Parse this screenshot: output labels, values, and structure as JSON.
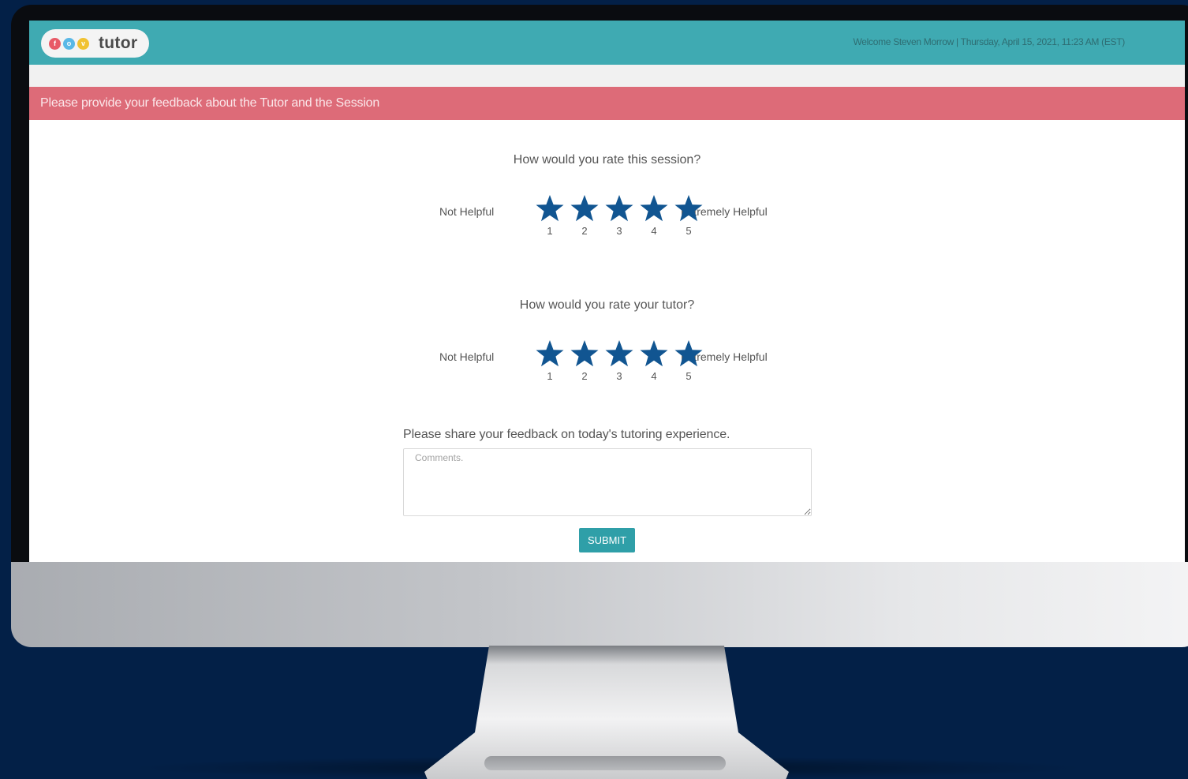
{
  "app": {
    "logo_text": "tutor",
    "logo_dots": [
      {
        "letter": "f",
        "color": "#e85a67"
      },
      {
        "letter": "o",
        "color": "#5ab8e6"
      },
      {
        "letter": "v",
        "color": "#f1c232"
      }
    ],
    "welcome_text": "Welcome Steven Morrow | Thursday, April 15, 2021, 11:23 AM (EST)"
  },
  "alert": {
    "text": "Please provide your feedback about the Tutor and the Session"
  },
  "ratings": [
    {
      "question": "How would you rate this session?",
      "low_label": "Not Helpful",
      "high_label": "Extremely Helpful",
      "scale": [
        "1",
        "2",
        "3",
        "4",
        "5"
      ]
    },
    {
      "question": "How would you rate your tutor?",
      "low_label": "Not Helpful",
      "high_label": "Extremely Helpful",
      "scale": [
        "1",
        "2",
        "3",
        "4",
        "5"
      ]
    }
  ],
  "feedback": {
    "label": "Please share your feedback on today's tutoring experience.",
    "placeholder": "Comments."
  },
  "submit_label": "SUBMIT",
  "colors": {
    "header": "#3faab2",
    "alert": "#dd6b78",
    "star": "#115591",
    "button": "#2f9fa8",
    "background": "#032047"
  }
}
